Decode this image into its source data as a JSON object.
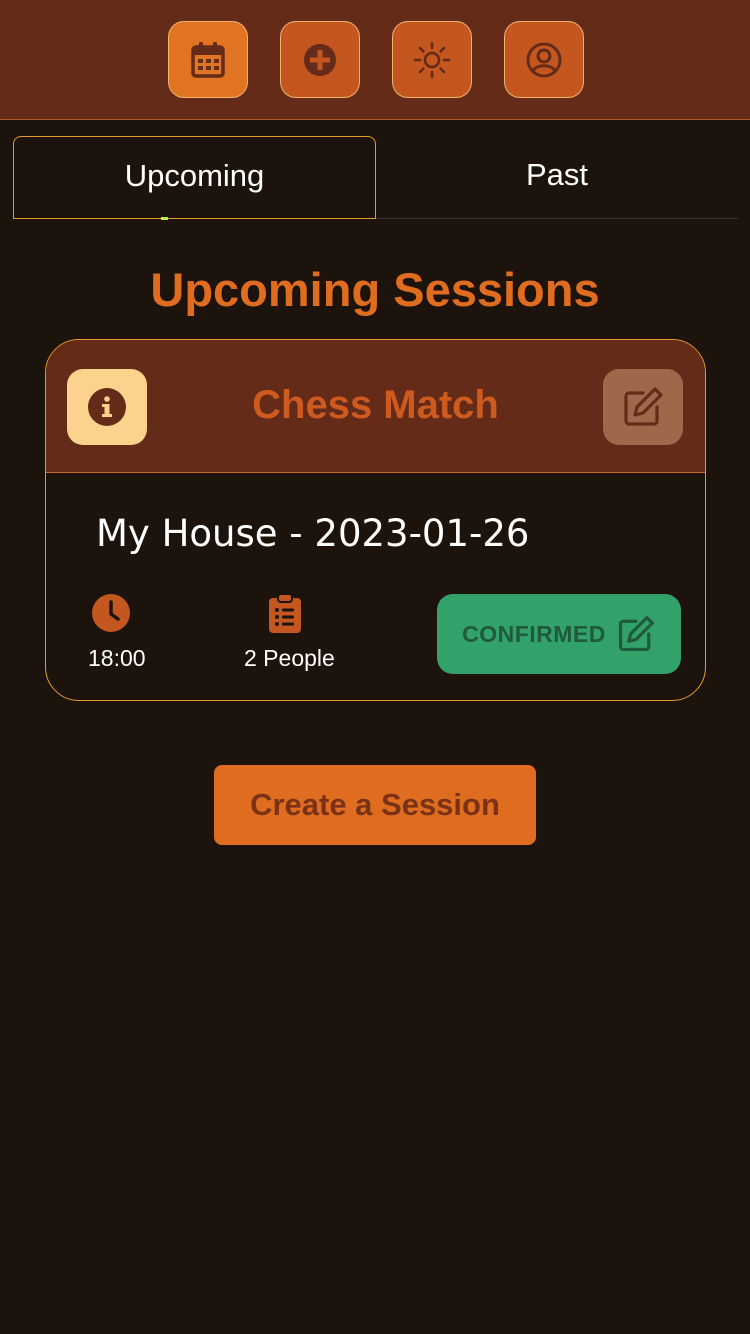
{
  "nav": {
    "items": [
      {
        "icon": "calendar-icon",
        "active": true
      },
      {
        "icon": "plus-circle-icon",
        "active": false
      },
      {
        "icon": "sun-icon",
        "active": false
      },
      {
        "icon": "user-circle-icon",
        "active": false
      }
    ]
  },
  "tabs": {
    "upcoming": "Upcoming",
    "past": "Past"
  },
  "section_title": "Upcoming Sessions",
  "session": {
    "title": "Chess Match",
    "location_date": "My House - 2023-01-26",
    "time": "18:00",
    "people": "2 People",
    "status": "CONFIRMED"
  },
  "create_button": "Create a Session",
  "colors": {
    "background": "#1c130c",
    "header": "#632b18",
    "accent": "#e06c20",
    "border": "#e59a2c",
    "confirmed": "#33a26a"
  }
}
